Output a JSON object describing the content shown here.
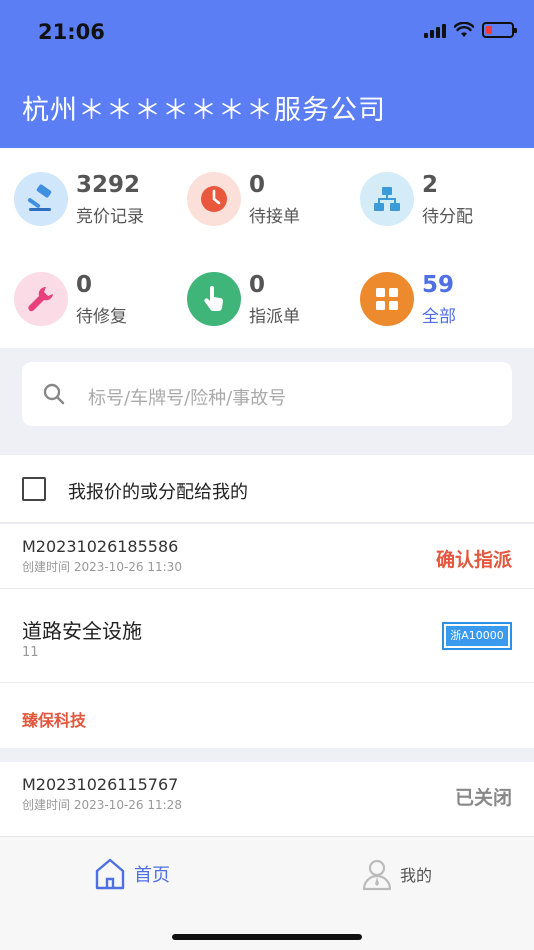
{
  "status_bar": {
    "time": "21:06"
  },
  "header": {
    "company": "杭州＊＊＊＊＊＊＊服务公司"
  },
  "stats": [
    {
      "value": "3292",
      "label": "竞价记录",
      "icon": "gavel-icon",
      "highlight": false
    },
    {
      "value": "0",
      "label": "待接单",
      "icon": "clock-icon",
      "highlight": false
    },
    {
      "value": "2",
      "label": "待分配",
      "icon": "hierarchy-icon",
      "highlight": false
    },
    {
      "value": "0",
      "label": "待修复",
      "icon": "wrench-icon",
      "highlight": false
    },
    {
      "value": "0",
      "label": "指派单",
      "icon": "hand-pointer-icon",
      "highlight": false
    },
    {
      "value": "59",
      "label": "全部",
      "icon": "grid-icon",
      "highlight": true
    }
  ],
  "search": {
    "placeholder": "标号/车牌号/险种/事故号"
  },
  "filter": {
    "label": "我报价的或分配给我的",
    "checked": false
  },
  "orders": [
    {
      "id": "M20231026185586",
      "created": "创建时间 2023-10-26 11:30",
      "status": "确认指派",
      "status_color": "#e2573d",
      "project": "道路安全设施",
      "project_number": "11",
      "plate": "浙A10000",
      "vendor": "臻保科技"
    },
    {
      "id": "M20231026115767",
      "created": "创建时间 2023-10-26 11:28",
      "status": "已关闭",
      "status_color": "#888888"
    }
  ],
  "tabbar": {
    "home": "首页",
    "mine": "我的"
  },
  "colors": {
    "primary": "#5b7ef5",
    "accent_red": "#e2573d",
    "tab_active": "#4f6fe3"
  }
}
